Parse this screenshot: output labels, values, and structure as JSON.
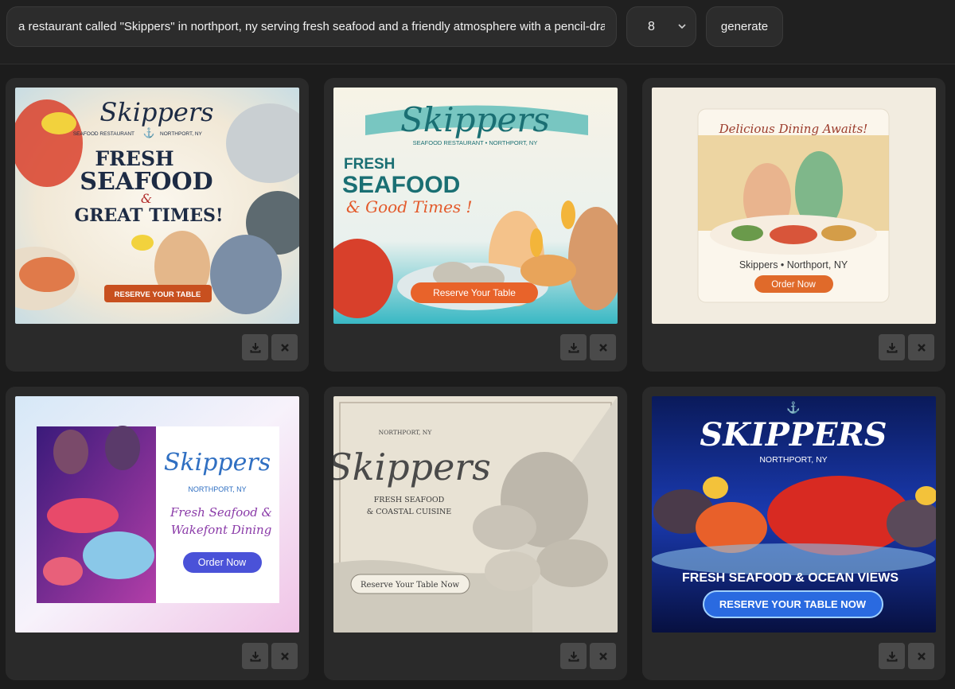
{
  "toolbar": {
    "prompt_value": "a restaurant called \"Skippers\" in northport, ny serving fresh seafood and a friendly atmosphere with a pencil-drawn st",
    "count_value": "8",
    "generate_label": "generate"
  },
  "colors": {
    "background": "#1c1c1c",
    "card": "#2a2a2a",
    "control": "#2c2c2c",
    "icon_button": "#4a4a4a"
  },
  "icons": {
    "download": "download-icon",
    "delete": "close-icon",
    "select": "chevron-down-icon"
  },
  "cards": [
    {
      "brand": "Skippers",
      "subtitle": "SEAFOOD RESTAURANT",
      "location": "NORTHPORT, NY",
      "line1": "FRESH",
      "line2": "SEAFOOD",
      "amp": "&",
      "line3": "GREAT TIMES!",
      "cta": "RESERVE YOUR TABLE"
    },
    {
      "brand": "Skippers",
      "subtitle": "SEAFOOD RESTAURANT • NORTHPORT, NY",
      "line1": "FRESH",
      "line2": "SEAFOOD",
      "line3": "& Good Times !",
      "cta": "Reserve Your Table"
    },
    {
      "headline": "Delicious Dining Awaits!",
      "location": "Skippers • Northport, NY",
      "cta": "Order Now"
    },
    {
      "brand": "Skippers",
      "location": "NORTHPORT, NY",
      "line1": "Fresh Seafood &",
      "line2": "Wakefont Dining",
      "cta": "Order Now"
    },
    {
      "location": "NORTHPORT, NY",
      "brand": "Skippers",
      "line1": "FRESH SEAFOOD",
      "line2": "& COASTAL CUISINE",
      "cta": "Reserve Your Table Now"
    },
    {
      "brand": "SKIPPERS",
      "location": "NORTHPORT, NY",
      "headline": "FRESH SEAFOOD & OCEAN VIEWS",
      "cta": "RESERVE YOUR TABLE NOW"
    }
  ]
}
